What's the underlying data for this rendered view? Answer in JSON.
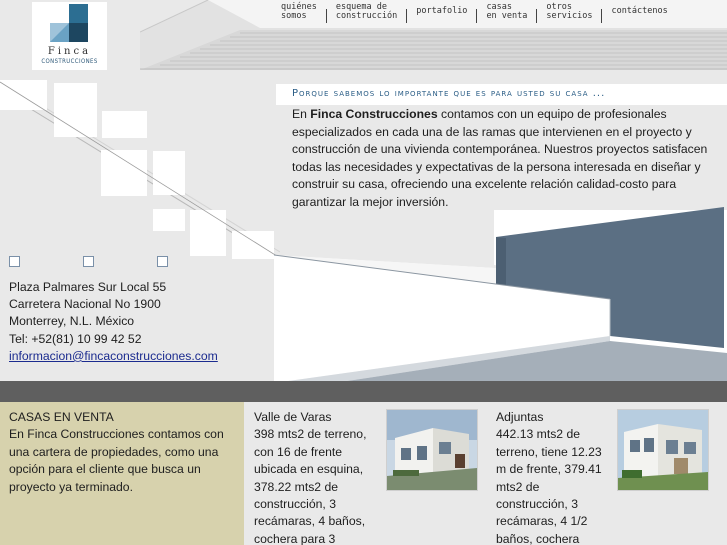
{
  "brand": {
    "name": "Finca",
    "sub": "CONSTRUCCIONES"
  },
  "nav": [
    {
      "label": "quiénes\nsomos"
    },
    {
      "label": "esquema de\nconstrucción"
    },
    {
      "label": "portafolio"
    },
    {
      "label": "casas\nen venta"
    },
    {
      "label": "otros\nservicios"
    },
    {
      "label": "contáctenos"
    }
  ],
  "tagline": "Porque sabemos lo importante que es para usted su casa ...",
  "intro": {
    "prefix": "En ",
    "company": "Finca Construcciones",
    "body": " contamos con un equipo de profesionales especializados en cada una de las ramas que intervienen en el proyecto y construcción de una vivienda contemporánea. Nuestros proyectos satisfacen todas las necesidades y expectativas de la persona interesada en diseñar y construir su casa, ofreciendo una excelente relación calidad-costo para garantizar la mejor inversión."
  },
  "address": {
    "line1": "Plaza Palmares Sur Local 55",
    "line2": "Carretera Nacional No 1900",
    "line3": "Monterrey, N.L. México",
    "phone": "Tel: +52(81) 10 99 42 52",
    "email": "informacion@fincaconstrucciones.com"
  },
  "sale": {
    "heading": "CASAS EN VENTA",
    "text": "En Finca Construcciones contamos con una cartera de propiedades, como una opción para el cliente que busca un proyecto ya terminado."
  },
  "properties": [
    {
      "name": "Valle de Varas",
      "desc": "398 mts2 de terreno, con 16 de frente ubicada en esquina, 378.22 mts2 de construcción, 3 recámaras, 4 baños, cochera para 3"
    },
    {
      "name": "Adjuntas",
      "desc": "442.13 mts2 de terreno, tiene 12.23 m de frente, 379.41 mts2 de construcción, 3 recámaras, 4 1/2 baños, cochera"
    }
  ],
  "colors": {
    "accent": "#2a5d86",
    "strip": "#5f5f5f",
    "sale_bg": "#d7d2ad",
    "page_bg": "#e9e9e9"
  }
}
